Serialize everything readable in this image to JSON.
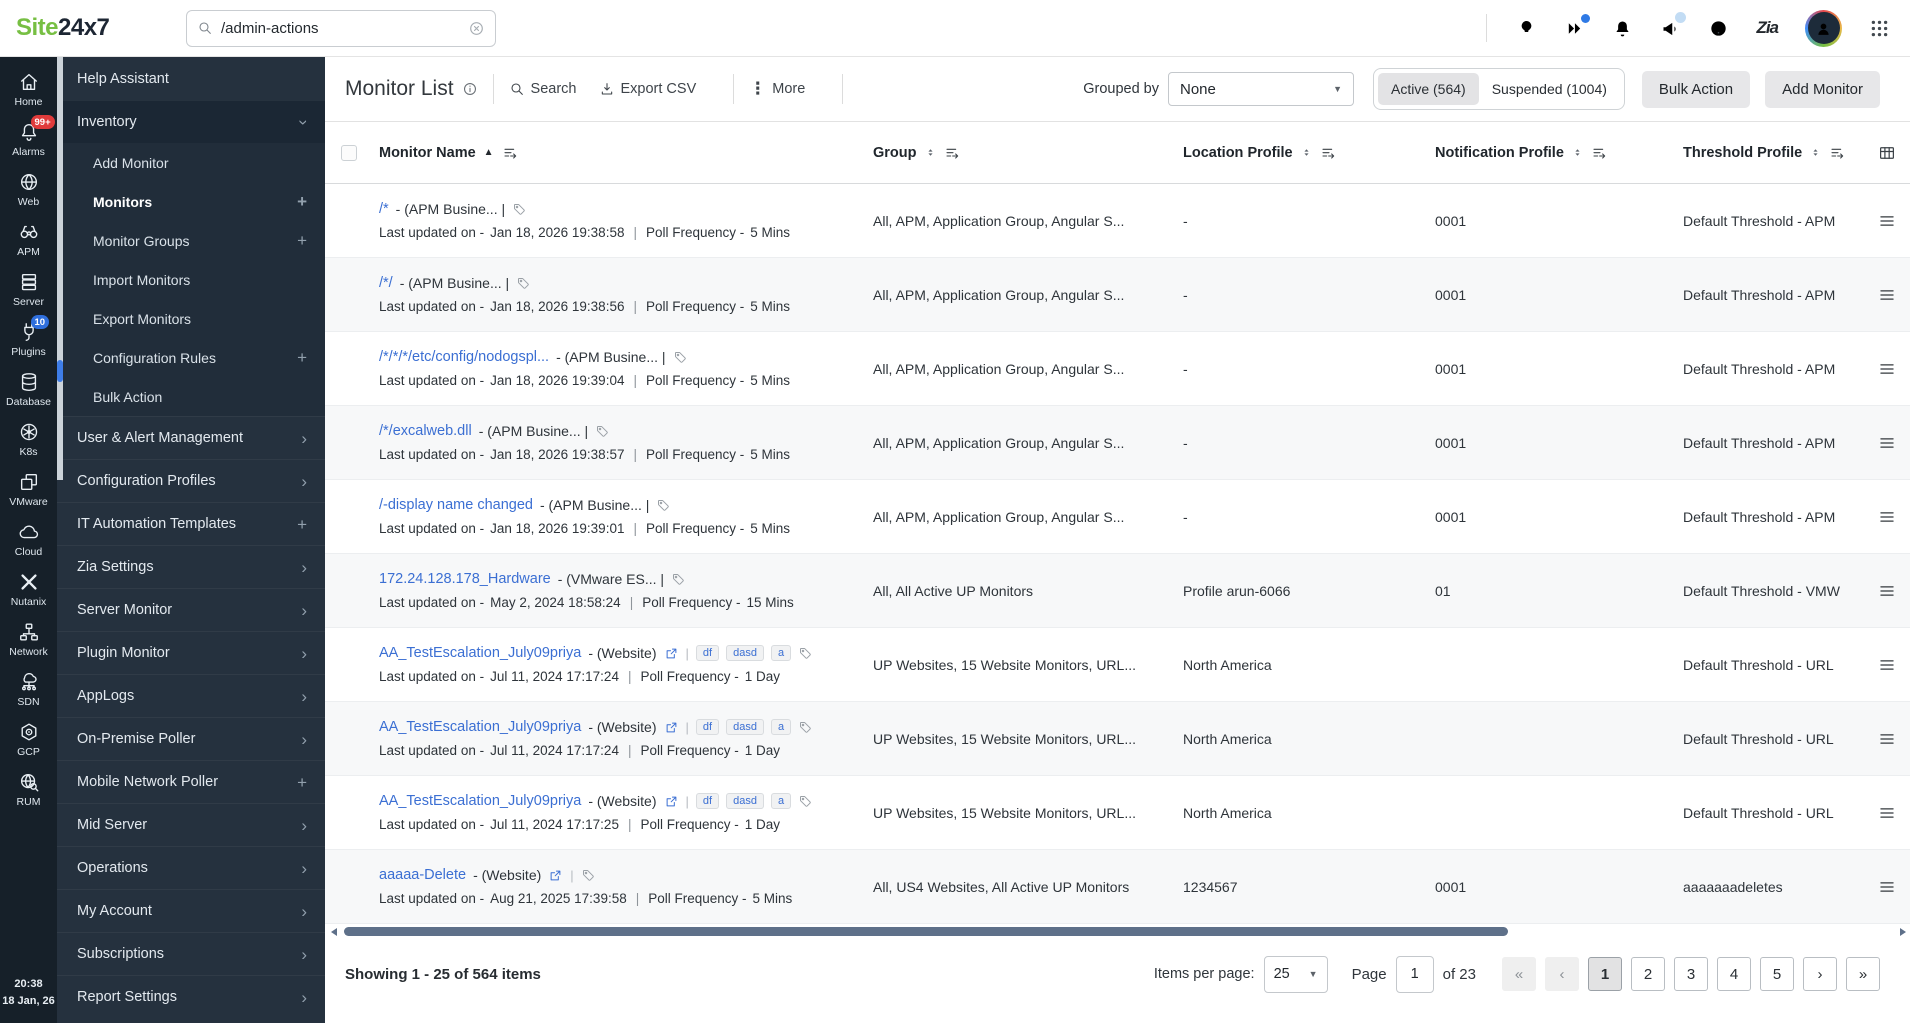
{
  "header": {
    "logo_site": "Site",
    "logo_rest": "24x7",
    "search_value": "/admin-actions",
    "zia_text": "Zia",
    "icons": [
      "bulb-icon",
      "fast-forward-icon",
      "bell-icon",
      "megaphone-icon",
      "question-icon",
      "zia-icon",
      "user-avatar",
      "apps-grid-icon"
    ]
  },
  "rail": {
    "items": [
      {
        "id": "rail-item-home",
        "icon": "home",
        "icon_name": "home-icon",
        "label": "Home"
      },
      {
        "id": "rail-item-alarms",
        "icon": "bell",
        "icon_name": "alarm-bell-icon",
        "label": "Alarms",
        "badge": "99+",
        "badge_cls": ""
      },
      {
        "id": "rail-item-web",
        "icon": "globe",
        "icon_name": "web-globe-icon",
        "label": "Web"
      },
      {
        "id": "rail-item-apm",
        "icon": "binoculars",
        "icon_name": "apm-binoculars-icon",
        "label": "APM"
      },
      {
        "id": "rail-item-server",
        "icon": "server",
        "icon_name": "server-stack-icon",
        "label": "Server"
      },
      {
        "id": "rail-item-plugins",
        "icon": "plug",
        "icon_name": "plugins-plug-icon",
        "label": "Plugins",
        "badge": "10",
        "badge_cls": "badge-blue"
      },
      {
        "id": "rail-item-database",
        "icon": "database",
        "icon_name": "database-icon",
        "label": "Database"
      },
      {
        "id": "rail-item-k8s",
        "icon": "k8s",
        "icon_name": "kubernetes-icon",
        "label": "K8s"
      },
      {
        "id": "rail-item-vmware",
        "icon": "vmware",
        "icon_name": "vmware-icon",
        "label": "VMware"
      },
      {
        "id": "rail-item-cloud",
        "icon": "cloud",
        "icon_name": "cloud-icon",
        "label": "Cloud"
      },
      {
        "id": "rail-item-nutanix",
        "icon": "nutanix",
        "icon_name": "nutanix-icon",
        "label": "Nutanix"
      },
      {
        "id": "rail-item-network",
        "icon": "network",
        "icon_name": "network-icon",
        "label": "Network"
      },
      {
        "id": "rail-item-sdn",
        "icon": "sdn",
        "icon_name": "sdn-cloud-icon",
        "label": "SDN"
      },
      {
        "id": "rail-item-gcp",
        "icon": "gcp",
        "icon_name": "gcp-hexagon-icon",
        "label": "GCP"
      },
      {
        "id": "rail-item-rum",
        "icon": "rum",
        "icon_name": "rum-globe-icon",
        "label": "RUM"
      }
    ],
    "time": "20:38",
    "date": "18 Jan, 26"
  },
  "sidebar": {
    "items": [
      {
        "id": "sidebar-item-help-assistant",
        "label": "Help Assistant"
      },
      {
        "id": "sidebar-item-inventory",
        "label": "Inventory",
        "cls": "section",
        "right_glyph": "›",
        "right_cls": "rot90",
        "right_name": "chevron-down-icon"
      },
      {
        "id": "sidebar-item-add-monitor",
        "label": "Add Monitor",
        "cls": "lvl1 inblock"
      },
      {
        "id": "sidebar-item-monitors",
        "label": "Monitors",
        "cls": "lvl1 inblock bold",
        "right_glyph": "+",
        "right_name": "plus-icon"
      },
      {
        "id": "sidebar-item-monitor-groups",
        "label": "Monitor Groups",
        "cls": "lvl1 inblock",
        "right_glyph": "+",
        "right_name": "plus-icon"
      },
      {
        "id": "sidebar-item-import-monitors",
        "label": "Import Monitors",
        "cls": "lvl1 inblock"
      },
      {
        "id": "sidebar-item-export-monitors",
        "label": "Export Monitors",
        "cls": "lvl1 inblock"
      },
      {
        "id": "sidebar-item-configuration-rules",
        "label": "Configuration Rules",
        "cls": "lvl1 inblock",
        "right_glyph": "+",
        "right_name": "plus-icon"
      },
      {
        "id": "sidebar-item-bulk-action",
        "label": "Bulk Action",
        "cls": "lvl1 inblock"
      },
      {
        "id": "sidebar-item-user-alert-management",
        "label": "User & Alert Management",
        "right_glyph": "›",
        "right_name": "chevron-right-icon"
      },
      {
        "id": "sidebar-item-configuration-profiles",
        "label": "Configuration Profiles",
        "right_glyph": "›",
        "right_name": "chevron-right-icon"
      },
      {
        "id": "sidebar-item-it-automation-templates",
        "label": "IT Automation Templates",
        "right_glyph": "+",
        "right_name": "plus-icon"
      },
      {
        "id": "sidebar-item-zia-settings",
        "label": "Zia Settings",
        "right_glyph": "›",
        "right_name": "chevron-right-icon"
      },
      {
        "id": "sidebar-item-server-monitor",
        "label": "Server Monitor",
        "right_glyph": "›",
        "right_name": "chevron-right-icon"
      },
      {
        "id": "sidebar-item-plugin-monitor",
        "label": "Plugin Monitor",
        "right_glyph": "›",
        "right_name": "chevron-right-icon"
      },
      {
        "id": "sidebar-item-applogs",
        "label": "AppLogs",
        "right_glyph": "›",
        "right_name": "chevron-right-icon"
      },
      {
        "id": "sidebar-item-on-premise-poller",
        "label": "On-Premise Poller",
        "right_glyph": "›",
        "right_name": "chevron-right-icon"
      },
      {
        "id": "sidebar-item-mobile-network-poller",
        "label": "Mobile Network Poller",
        "right_glyph": "+",
        "right_name": "plus-icon"
      },
      {
        "id": "sidebar-item-mid-server",
        "label": "Mid Server",
        "right_glyph": "›",
        "right_name": "chevron-right-icon"
      },
      {
        "id": "sidebar-item-operations",
        "label": "Operations",
        "right_glyph": "›",
        "right_name": "chevron-right-icon"
      },
      {
        "id": "sidebar-item-my-account",
        "label": "My Account",
        "right_glyph": "›",
        "right_name": "chevron-right-icon"
      },
      {
        "id": "sidebar-item-subscriptions",
        "label": "Subscriptions",
        "right_glyph": "›",
        "right_name": "chevron-right-icon"
      },
      {
        "id": "sidebar-item-report-settings",
        "label": "Report Settings",
        "right_glyph": "›",
        "right_name": "chevron-right-icon"
      }
    ]
  },
  "toolbar": {
    "title": "Monitor List",
    "search_label": "Search",
    "export_label": "Export CSV",
    "more_label": "More",
    "grouped_by_label": "Grouped by",
    "grouped_by_value": "None",
    "active_label": "Active (564)",
    "suspended_label": "Suspended (1004)",
    "bulk_action_label": "Bulk Action",
    "add_monitor_label": "Add Monitor"
  },
  "table": {
    "columns": [
      {
        "label": "Monitor Name",
        "sort": "asc"
      },
      {
        "label": "Group",
        "sort": "both"
      },
      {
        "label": "Location Profile",
        "sort": "both"
      },
      {
        "label": "Notification Profile",
        "sort": "both"
      },
      {
        "label": "Threshold Profile",
        "sort": "both"
      }
    ],
    "labels": {
      "updated": "Last updated on -",
      "poll": "Poll Frequency -"
    },
    "rows": [
      {
        "name": "/*",
        "type": "- (APM Busine... |",
        "website": false,
        "badges": [],
        "updated": "Jan 18, 2026 19:38:58",
        "poll": "5 Mins",
        "group": "All, APM, Application Group, Angular S...",
        "location": "-",
        "notification": "0001",
        "threshold": "Default Threshold - APM"
      },
      {
        "name": "/*/",
        "type": "- (APM Busine... |",
        "website": false,
        "badges": [],
        "updated": "Jan 18, 2026 19:38:56",
        "poll": "5 Mins",
        "group": "All, APM, Application Group, Angular S...",
        "location": "-",
        "notification": "0001",
        "threshold": "Default Threshold - APM"
      },
      {
        "name": "/*/*/*/etc/config/nodogspl...",
        "type": "- (APM Busine... |",
        "website": false,
        "badges": [],
        "updated": "Jan 18, 2026 19:39:04",
        "poll": "5 Mins",
        "group": "All, APM, Application Group, Angular S...",
        "location": "-",
        "notification": "0001",
        "threshold": "Default Threshold - APM"
      },
      {
        "name": "/*/excalweb.dll",
        "type": "- (APM Busine... |",
        "website": false,
        "badges": [],
        "updated": "Jan 18, 2026 19:38:57",
        "poll": "5 Mins",
        "group": "All, APM, Application Group, Angular S...",
        "location": "-",
        "notification": "0001",
        "threshold": "Default Threshold - APM"
      },
      {
        "name": "/-display name changed",
        "type": "- (APM Busine... |",
        "website": false,
        "badges": [],
        "updated": "Jan 18, 2026 19:39:01",
        "poll": "5 Mins",
        "group": "All, APM, Application Group, Angular S...",
        "location": "-",
        "notification": "0001",
        "threshold": "Default Threshold - APM"
      },
      {
        "name": "172.24.128.178_Hardware",
        "type": "- (VMware ES... |",
        "website": false,
        "badges": [],
        "updated": "May 2, 2024 18:58:24",
        "poll": "15 Mins",
        "group": "All, All Active UP Monitors",
        "location": "Profile arun-6066",
        "notification": "01",
        "threshold": "Default Threshold - VMW"
      },
      {
        "name": "AA_TestEscalation_July09priya",
        "type": "- (Website)",
        "website": true,
        "badges": [
          "df",
          "dasd",
          "a"
        ],
        "updated": "Jul 11, 2024 17:17:24",
        "poll": "1 Day",
        "group": "UP Websites, 15 Website Monitors, URL...",
        "location": "North America",
        "notification": "",
        "threshold": "Default Threshold - URL"
      },
      {
        "name": "AA_TestEscalation_July09priya",
        "type": "- (Website)",
        "website": true,
        "badges": [
          "df",
          "dasd",
          "a"
        ],
        "updated": "Jul 11, 2024 17:17:24",
        "poll": "1 Day",
        "group": "UP Websites, 15 Website Monitors, URL...",
        "location": "North America",
        "notification": "",
        "threshold": "Default Threshold - URL"
      },
      {
        "name": "AA_TestEscalation_July09priya",
        "type": "- (Website)",
        "website": true,
        "badges": [
          "df",
          "dasd",
          "a"
        ],
        "updated": "Jul 11, 2024 17:17:25",
        "poll": "1 Day",
        "group": "UP Websites, 15 Website Monitors, URL...",
        "location": "North America",
        "notification": "",
        "threshold": "Default Threshold - URL"
      },
      {
        "name": "aaaaa-Delete",
        "type": "- (Website)",
        "website": true,
        "badges": [],
        "updated": "Aug 21, 2025 17:39:58",
        "poll": "5 Mins",
        "group": "All, US4 Websites, All Active UP Monitors",
        "location": "1234567",
        "notification": "0001",
        "threshold": "aaaaaaadeletes"
      }
    ]
  },
  "footer": {
    "showing": "Showing 1 - 25 of 564 items",
    "items_per_page_label": "Items per page:",
    "items_per_page_value": "25",
    "page_label": "Page",
    "page_value": "1",
    "page_total": "of 23",
    "pages": [
      {
        "label": "«",
        "cls": "pg-dis",
        "id": "page-first-button"
      },
      {
        "label": "‹",
        "cls": "pg-dis",
        "id": "page-prev-button"
      },
      {
        "label": "1",
        "cls": "pg-active",
        "id": "page-1-button"
      },
      {
        "label": "2",
        "cls": "",
        "id": "page-2-button"
      },
      {
        "label": "3",
        "cls": "",
        "id": "page-3-button"
      },
      {
        "label": "4",
        "cls": "",
        "id": "page-4-button"
      },
      {
        "label": "5",
        "cls": "",
        "id": "page-5-button"
      },
      {
        "label": "›",
        "cls": "",
        "id": "page-next-button"
      },
      {
        "label": "»",
        "cls": "",
        "id": "page-last-button"
      }
    ]
  }
}
